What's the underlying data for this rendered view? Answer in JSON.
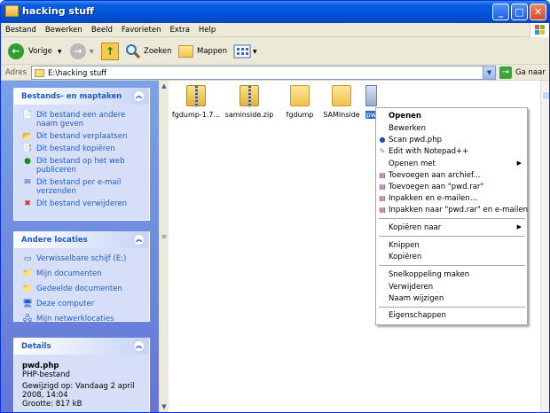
{
  "window": {
    "title": "hacking stuff",
    "minimize": "_",
    "maximize": "□",
    "close": "✕"
  },
  "menubar": [
    "Bestand",
    "Bewerken",
    "Beeld",
    "Favorieten",
    "Extra",
    "Help"
  ],
  "toolbar": {
    "back": "Vorige",
    "search": "Zoeken",
    "folders": "Mappen"
  },
  "address": {
    "label": "Adres",
    "value": "E:\\hacking stuff",
    "go": "Ga naar"
  },
  "tasks": {
    "title": "Bestands- en maptaken",
    "items": [
      "Dit bestand een andere naam geven",
      "Dit bestand verplaatsen",
      "Dit bestand kopiëren",
      "Dit bestand op het web publiceren",
      "Dit bestand per e-mail verzenden",
      "Dit bestand verwijderen"
    ]
  },
  "places": {
    "title": "Andere locaties",
    "items": [
      "Verwisselbare schijf (E:)",
      "Mijn documenten",
      "Gedeelde documenten",
      "Deze computer",
      "Mijn netwerklocaties"
    ]
  },
  "details": {
    "title": "Details",
    "name": "pwd.php",
    "type": "PHP-bestand",
    "modified": "Gewijzigd op: Vandaag 2 april 2008, 14:04",
    "size": "Grootte: 817 kB"
  },
  "files": [
    "fgdump-1.7...",
    "saminside.zip",
    "fgdump",
    "SAMInside",
    "pw"
  ],
  "context_menu": [
    "Openen",
    "Bewerken",
    "Scan pwd.php",
    "Edit with Notepad++",
    "Openen met",
    "Toevoegen aan archief...",
    "Toevoegen aan \"pwd.rar\"",
    "Inpakken en e-mailen...",
    "Inpakken naar \"pwd.rar\" en e-mailen",
    "Kopiëren naar",
    "Knippen",
    "Kopiëren",
    "Snelkoppeling maken",
    "Verwijderen",
    "Naam wijzigen",
    "Eigenschappen"
  ],
  "colors": {
    "title_bar": "#0052d6",
    "task_pane": "#6375d6",
    "link": "#215dc6"
  }
}
